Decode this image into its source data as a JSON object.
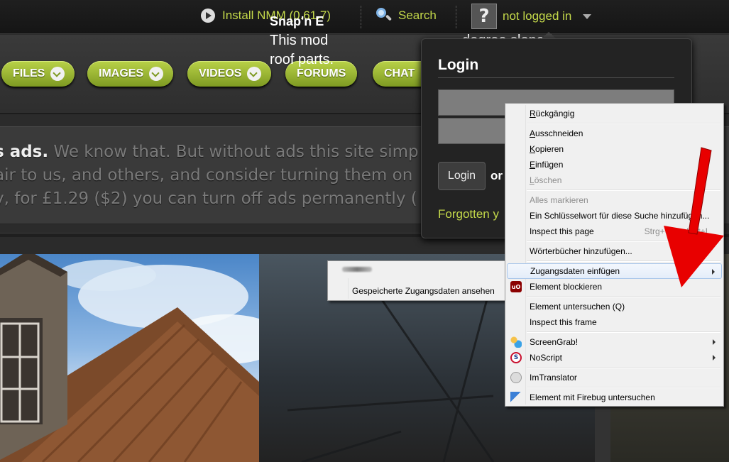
{
  "topbar": {
    "install_label": "Install NMM (0.61.7)",
    "search_label": "Search",
    "avatar_glyph": "?",
    "user_status": "not logged in"
  },
  "nav": {
    "items": [
      {
        "label": "FILES"
      },
      {
        "label": "IMAGES"
      },
      {
        "label": "VIDEOS"
      },
      {
        "label": "FORUMS"
      },
      {
        "label": "CHAT"
      }
    ]
  },
  "ads_notice": {
    "line1_bold": "s ads.",
    "line1_rest": " We know that. But without ads this site simp",
    "line2": "air to us, and others, and consider turning them on",
    "line3": "y, for £1.29 ($2) you can turn off ads permanently ("
  },
  "content": {
    "title": "Snap'n E",
    "description": "This mod                                  degree sloped roof parts."
  },
  "login": {
    "title": "Login",
    "button_label": "Login",
    "or_text": "or",
    "forgotten_text": "Forgotten y"
  },
  "context_menu": {
    "items": [
      {
        "label": "Rückgängig",
        "underline_index": 0
      },
      {
        "label": "Ausschneiden",
        "underline_index": 0
      },
      {
        "label": "Kopieren",
        "underline_index": 0
      },
      {
        "label": "Einfügen",
        "underline_index": 0
      },
      {
        "label": "Löschen",
        "underline_index": 0,
        "disabled": true
      },
      {
        "label": "Alles markieren",
        "disabled": true
      },
      {
        "label": "Ein Schlüsselwort für diese Suche hinzufügen..."
      },
      {
        "label": "Inspect this page",
        "shortcut": "Strg+Umschalt+I"
      },
      {
        "label": "Wörterbücher hinzufügen..."
      },
      {
        "label": "Zugangsdaten einfügen"
      },
      {
        "label": "Element blockieren"
      },
      {
        "label": "Element untersuchen (Q)"
      },
      {
        "label": "Inspect this frame"
      },
      {
        "label": "ScreenGrab!"
      },
      {
        "label": "NoScript"
      },
      {
        "label": "ImTranslator"
      },
      {
        "label": "Element mit Firebug untersuchen"
      }
    ],
    "icons": {
      "ublock": "ublock-icon",
      "screengrab": "screengrab-icon",
      "noscript": "noscript-icon",
      "imtranslator": "imtranslator-icon",
      "firebug": "firebug-icon"
    }
  },
  "submenu": {
    "item": "Gespeicherte Zugangsdaten ansehen"
  },
  "colors": {
    "accent_green": "#c4d94a",
    "nav_pill": "#9fb83a",
    "annotation_red": "#e80000"
  }
}
